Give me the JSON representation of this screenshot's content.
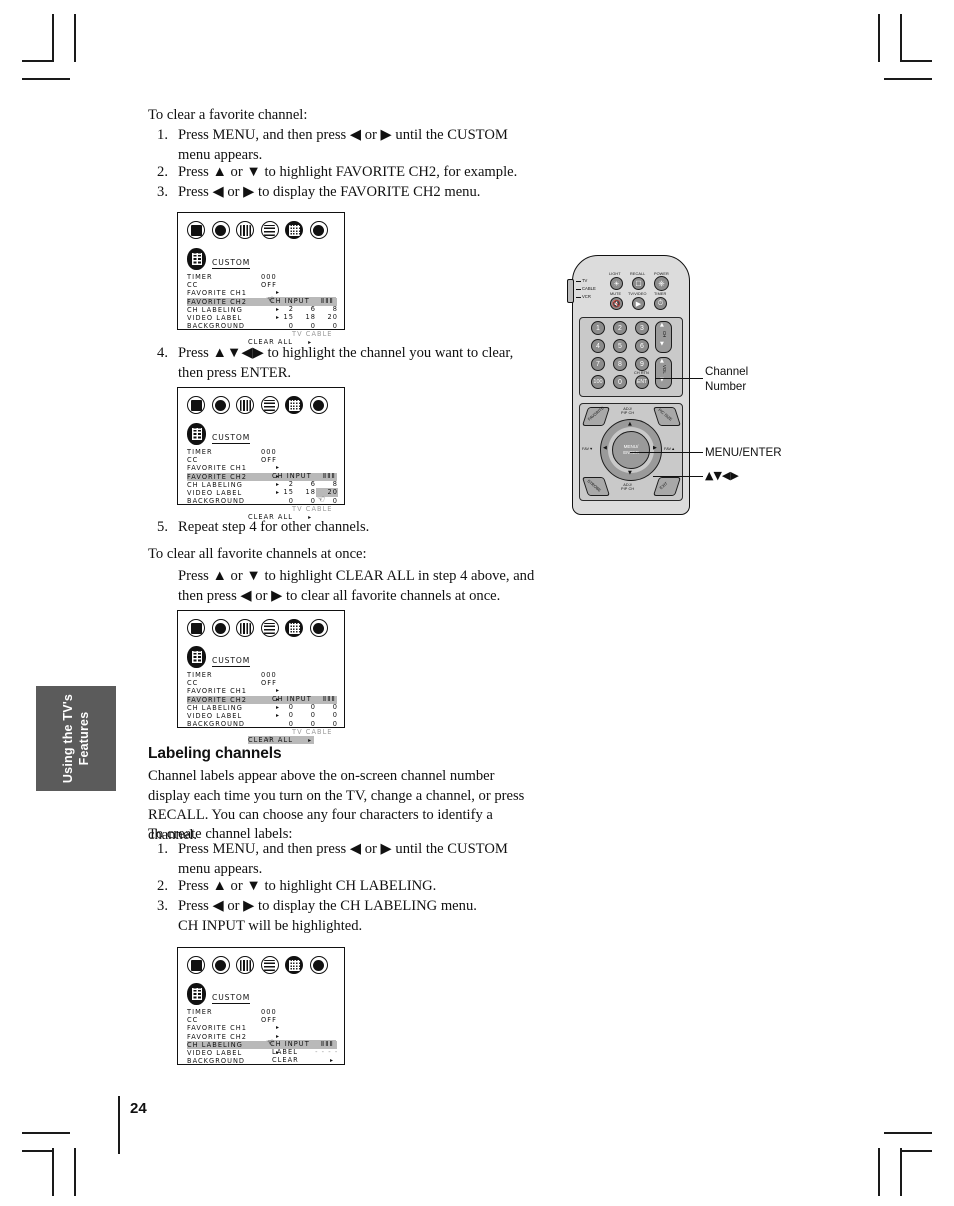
{
  "page": {
    "number": "24",
    "side_tab": [
      "Using the TV's",
      "Features"
    ]
  },
  "body": {
    "clear_fav_intro": "To clear a favorite channel:",
    "steps_clear": [
      {
        "n": "1.",
        "text": "Press MENU, and then press ◀ or ▶ until the CUSTOM menu appears."
      },
      {
        "n": "2.",
        "text": "Press ▲ or ▼ to highlight FAVORITE CH2, for example."
      },
      {
        "n": "3.",
        "text": "Press ◀ or ▶ to display the FAVORITE CH2 menu."
      }
    ],
    "step4": {
      "n": "4.",
      "text": "Press ▲▼◀▶ to highlight the channel you want to clear, then press ENTER."
    },
    "step5": {
      "n": "5.",
      "text": "Repeat step 4 for other channels."
    },
    "clear_all_intro": "To clear all favorite channels at once:",
    "clear_all_body": "Press ▲ or ▼ to highlight CLEAR ALL in step 4 above, and then press ◀ or ▶ to clear all favorite channels at once.",
    "section_title": "Labeling channels",
    "section_para": "Channel labels appear above the on-screen channel number display each time you turn on the TV, change a channel, or press RECALL. You can choose any four characters to identify a channel.",
    "create_intro": "To create channel labels:",
    "steps_label": [
      {
        "n": "1.",
        "text": "Press MENU, and then press ◀ or ▶ until the CUSTOM menu appears."
      },
      {
        "n": "2.",
        "text": "Press ▲ or ▼ to highlight CH LABELING."
      },
      {
        "n": "3.",
        "text": "Press ◀ or ▶ to display the CH LABELING menu."
      }
    ],
    "step3_note": "CH INPUT will be highlighted."
  },
  "osd": {
    "menu_name": "CUSTOM",
    "icons": [
      "picture-icon",
      "audio-icon",
      "setup-icon",
      "lock-icon",
      "custom-icon",
      "exit-icon"
    ],
    "labels": [
      "TIMER",
      "CC",
      "FAVORITE CH1",
      "FAVORITE CH2",
      "CH LABELING",
      "VIDEO LABEL",
      "BACKGROUND"
    ],
    "timer_value": "000",
    "cc_value": "OFF",
    "arrow": "▸",
    "panel_header": "CH  INPUT",
    "panel_header_right": "ⅡⅡⅡ",
    "clear_all": "CLEAR ALL",
    "tv_cable": "TV  CABLE",
    "label_row": "LABEL",
    "label_dashes": "- - - -",
    "clear_row": "CLEAR"
  },
  "screens": [
    {
      "id": "screen-favorite-ch2",
      "highlight_row": 3,
      "panel_rows": [
        [
          "2",
          "6",
          "8"
        ],
        [
          "15",
          "18",
          "20"
        ],
        [
          "0",
          "0",
          "0"
        ]
      ],
      "cursor": true,
      "cursor_pos": "panel-header",
      "highlight_cell": null,
      "clear_all_highlight": false
    },
    {
      "id": "screen-favorite-ch2-select",
      "highlight_row": 3,
      "panel_rows": [
        [
          "2",
          "6",
          "8"
        ],
        [
          "15",
          "18",
          "20"
        ],
        [
          "0",
          "0",
          "0"
        ]
      ],
      "cursor": true,
      "cursor_pos": "cell-1-2",
      "highlight_cell": "1-2",
      "clear_all_highlight": false
    },
    {
      "id": "screen-clear-all",
      "highlight_row": 3,
      "panel_rows": [
        [
          "0",
          "0",
          "0"
        ],
        [
          "0",
          "0",
          "0"
        ],
        [
          "0",
          "0",
          "0"
        ]
      ],
      "cursor": true,
      "cursor_pos": "clear-all",
      "highlight_cell": null,
      "clear_all_highlight": true
    },
    {
      "id": "screen-ch-labeling",
      "highlight_row": 4,
      "panel_rows": null,
      "cursor": true,
      "cursor_pos": "panel-header",
      "highlight_cell": null,
      "clear_all_highlight": false
    }
  ],
  "remote": {
    "mode_labels": [
      "TV",
      "CABLE",
      "VCR"
    ],
    "top_labels": [
      "LIGHT",
      "RECALL",
      "POWER",
      "MUTE",
      "TV/VIDEO",
      "TIMER"
    ],
    "keypad": [
      "1",
      "2",
      "3",
      "4",
      "5",
      "6",
      "7",
      "8",
      "9",
      "100",
      "0",
      "ENT"
    ],
    "ch_rtn": "CH RTN",
    "ch_label": "CH",
    "vol_label": "VOL",
    "pad_top": "ADJ/\nPIP CH",
    "pad_bottom": "ADJ/\nPIP CH",
    "pad_center": "MENU/\nENTER",
    "fav_down": "FAV▼",
    "fav_up": "FAV▲",
    "corner_labels": [
      "FAVORITE",
      "PIC SIZE",
      "STROBE",
      "EXIT"
    ]
  },
  "callouts": {
    "channel_number": [
      "Channel",
      "Number"
    ],
    "menu_enter": "MENU/ENTER",
    "arrows": "▲▼◀▶"
  }
}
